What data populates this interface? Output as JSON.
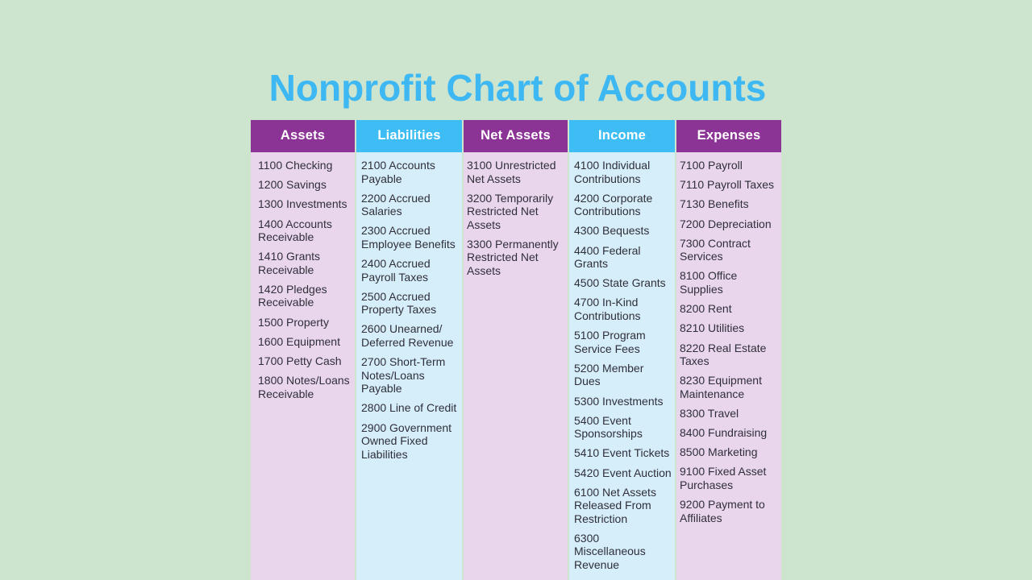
{
  "title": "Nonprofit Chart of Accounts",
  "colors": {
    "title": "#3db8f2",
    "background": "#cde4cf",
    "header_purple": "#8c3396",
    "header_blue": "#3dbdf3",
    "body_purple": "#ead6ec",
    "body_blue": "#d6eefa"
  },
  "columns": [
    {
      "header": "Assets",
      "items": [
        "1100 Checking",
        "1200 Savings",
        "1300 Investments",
        "1400 Accounts Receivable",
        "1410 Grants Receivable",
        "1420 Pledges Receivable",
        "1500 Property",
        "1600 Equipment",
        "1700 Petty Cash",
        "1800 Notes/Loans Receivable"
      ]
    },
    {
      "header": "Liabilities",
      "items": [
        "2100 Accounts Payable",
        "2200 Accrued Salaries",
        "2300 Accrued Employee Benefits",
        "2400 Accrued Payroll Taxes",
        "2500 Accrued Property Taxes",
        "2600 Unearned/ Deferred Revenue",
        "2700 Short-Term Notes/Loans Payable",
        "2800 Line of Credit",
        "2900 Government Owned Fixed Liabilities"
      ]
    },
    {
      "header": "Net Assets",
      "items": [
        "3100 Unrestricted Net Assets",
        "3200 Temporarily Restricted Net Assets",
        "3300 Permanently Restricted Net Assets"
      ]
    },
    {
      "header": "Income",
      "items": [
        "4100 Individual Contributions",
        "4200 Corporate Contributions",
        "4300 Bequests",
        "4400 Federal Grants",
        "4500 State Grants",
        "4700 In-Kind Contributions",
        "5100 Program Service Fees",
        "5200 Member Dues",
        "5300 Investments",
        "5400 Event Sponsorships",
        "5410 Event Tickets",
        "5420 Event Auction",
        "6100 Net Assets Released From Restriction",
        "6300 Miscellaneous Revenue"
      ]
    },
    {
      "header": "Expenses",
      "items": [
        "7100 Payroll",
        "7110 Payroll Taxes",
        "7130 Benefits",
        "7200 Depreciation",
        "7300 Contract Services",
        "8100 Office Supplies",
        "8200 Rent",
        "8210 Utilities",
        "8220 Real Estate Taxes",
        "8230 Equipment Maintenance",
        "8300 Travel",
        "8400 Fundraising",
        "8500 Marketing",
        "9100 Fixed Asset Purchases",
        "9200 Payment to Affiliates"
      ]
    }
  ]
}
